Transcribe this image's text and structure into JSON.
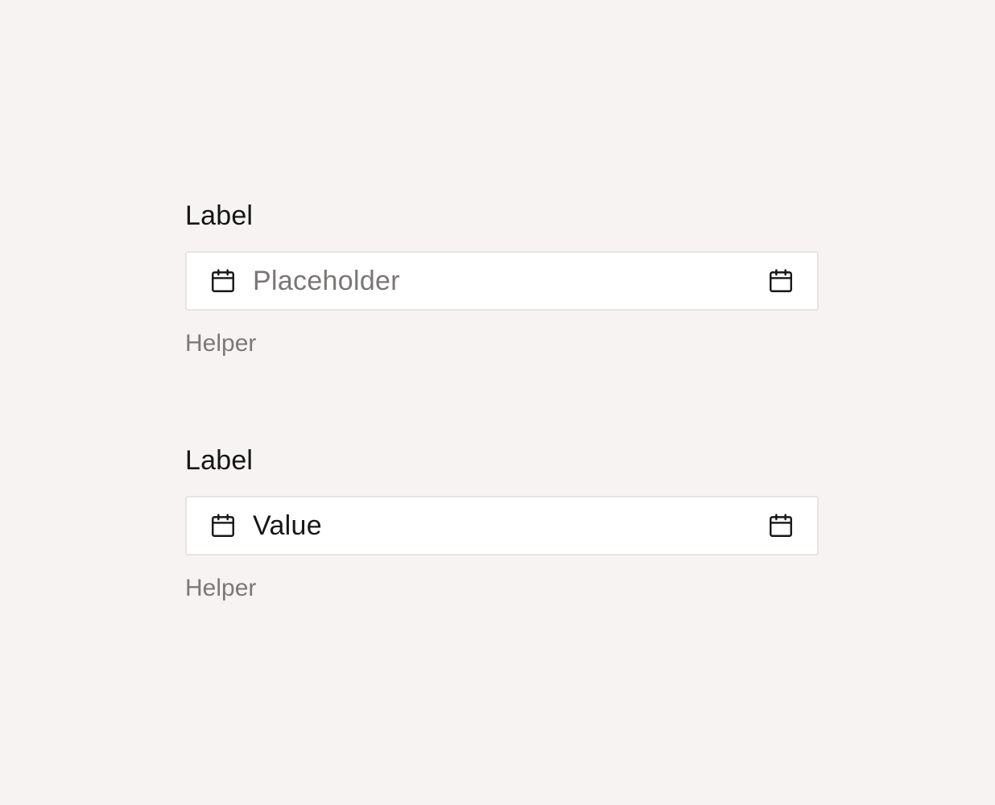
{
  "fields": [
    {
      "label": "Label",
      "placeholder": "Placeholder",
      "value": "",
      "helper": "Helper",
      "leading_icon": "calendar-icon",
      "trailing_icon": "calendar-icon"
    },
    {
      "label": "Label",
      "placeholder": "",
      "value": "Value",
      "helper": "Helper",
      "leading_icon": "calendar-icon",
      "trailing_icon": "calendar-icon"
    }
  ],
  "colors": {
    "background": "#f7f3f3",
    "input_background": "#ffffff",
    "input_border": "#e6e3e3",
    "text": "#161616",
    "placeholder": "#7a7676",
    "helper": "#7d7878"
  }
}
